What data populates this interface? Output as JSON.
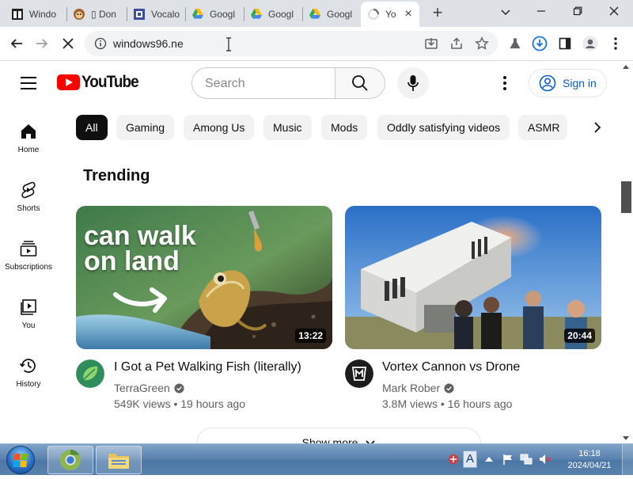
{
  "browser": {
    "tabs": [
      {
        "title": "Windo",
        "icon": "window-icon"
      },
      {
        "title": "▯ Don",
        "icon": "monkey-icon"
      },
      {
        "title": "Vocalo",
        "icon": "vocaloid-icon"
      },
      {
        "title": "Googl",
        "icon": "google-drive-icon"
      },
      {
        "title": "Googl",
        "icon": "google-drive-icon"
      },
      {
        "title": "Googl",
        "icon": "google-drive-icon"
      },
      {
        "title": "Yo",
        "icon": "loading-spinner-icon",
        "active": true
      }
    ],
    "address": "windows96.ne"
  },
  "youtube": {
    "logo_text": "YouTube",
    "search_placeholder": "Search",
    "sign_in": "Sign in",
    "guide": [
      "Home",
      "Shorts",
      "Subscriptions",
      "You",
      "History"
    ],
    "chips": [
      "All",
      "Gaming",
      "Among Us",
      "Music",
      "Mods",
      "Oddly satisfying videos",
      "ASMR"
    ],
    "section_title": "Trending",
    "videos": [
      {
        "title": "I Got a Pet Walking Fish (literally)",
        "channel": "TerraGreen",
        "views": "549K views",
        "age": "19 hours ago",
        "meta": "549K views • 19 hours ago",
        "duration": "13:22",
        "thumb_text_1": "can walk",
        "thumb_text_2": "on land"
      },
      {
        "title": "Vortex Cannon vs Drone",
        "channel": "Mark Rober",
        "views": "3.8M views",
        "age": "16 hours ago",
        "meta": "3.8M views • 16 hours ago",
        "duration": "20:44"
      }
    ],
    "show_more": "Show more"
  },
  "taskbar": {
    "time": "16:18",
    "date": "2024/04/21",
    "ime": "A"
  },
  "colors": {
    "youtube_red": "#ff0000",
    "link_blue": "#065fd4",
    "chip_selected": "#0f0f0f",
    "taskbar": "#5c84b0"
  }
}
